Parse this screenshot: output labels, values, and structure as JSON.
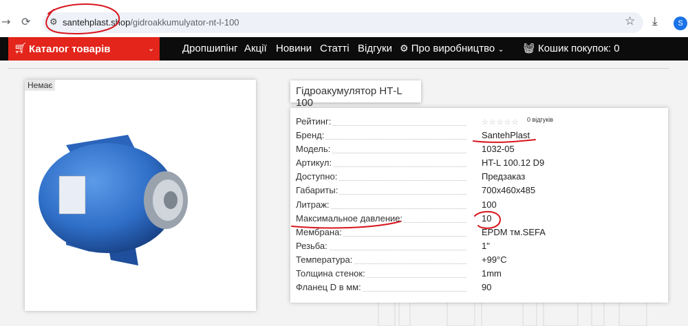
{
  "browser": {
    "url_host": "santehplast.shop",
    "url_path": "/gidroakkumulyator-nt-l-100",
    "avatar_letter": "S"
  },
  "nav": {
    "catalog_label": "Каталог товарів",
    "items": [
      "Дропшипінг",
      "Акції",
      "Новини",
      "Статті",
      "Відгуки"
    ],
    "producer_label": "Про виробництво",
    "cart_label": "Кошик покупок: 0"
  },
  "product": {
    "badge": "Немає",
    "title": "Гідроакумулятор НТ-L 100",
    "rating_label": "Рейтинг:",
    "rating_stars": 0,
    "reviews_text": "0 відгуків",
    "specs": [
      {
        "key": "Бренд:",
        "value": "SantehPlast"
      },
      {
        "key": "Модель:",
        "value": "1032-05"
      },
      {
        "key": "Артикул:",
        "value": "HT-L 100.12 D9"
      },
      {
        "key": "Доступно:",
        "value": "Предзаказ"
      },
      {
        "key": "Габариты:",
        "value": "700х460х485"
      },
      {
        "key": "Литраж:",
        "value": "100"
      },
      {
        "key": "Максимальное давление:",
        "value": "10"
      },
      {
        "key": "Мембрана:",
        "value": "EPDM тм.SEFA"
      },
      {
        "key": "Резьба:",
        "value": "1\""
      },
      {
        "key": "Температура:",
        "value": "+99°С"
      },
      {
        "key": "Толщина стенок:",
        "value": "1mm"
      },
      {
        "key": "Фланец D в мм:",
        "value": "90"
      }
    ]
  },
  "colors": {
    "accent": "#e3251b",
    "navbar": "#0c0c0c",
    "annotation": "#d8141c",
    "tank": "#2f6fc8"
  },
  "icons": [
    "back-arrow-icon",
    "reload-icon",
    "site-info-icon",
    "bookmark-star-icon",
    "download-icon",
    "cart-icon",
    "chevron-down-icon",
    "gear-icon",
    "basket-icon",
    "star-icon"
  ]
}
